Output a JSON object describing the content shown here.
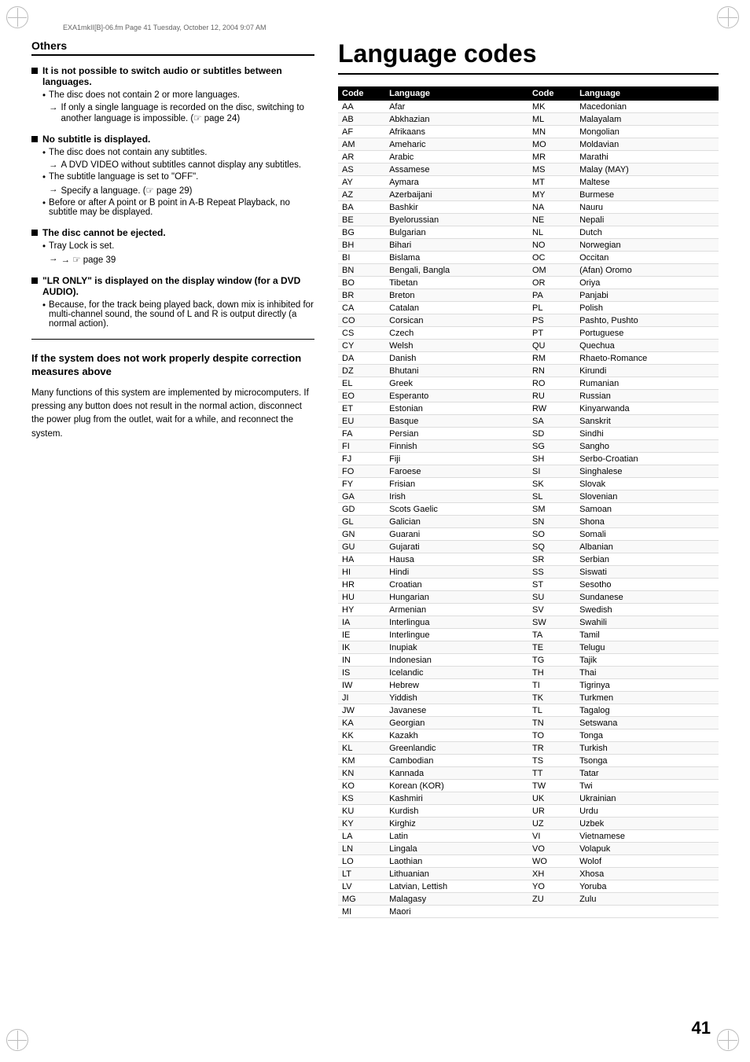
{
  "page": {
    "file_header": "EXA1mkII[B]-06.fm  Page 41  Tuesday, October 12, 2004  9:07 AM",
    "title": "Language codes",
    "page_number": "41"
  },
  "left": {
    "section_heading": "Others",
    "bullets": [
      {
        "id": "bullet1",
        "title": "It is not possible to switch audio or subtitles between languages.",
        "sub_items": [
          {
            "type": "bullet",
            "text": "The disc does not contain 2 or more languages."
          },
          {
            "type": "arrow",
            "text": "If only a single language is recorded on the disc, switching to another language is impossible. ("
          },
          {
            "type": "arrow_ref",
            "text": " page 24)"
          }
        ]
      },
      {
        "id": "bullet2",
        "title": "No subtitle is displayed.",
        "sub_items": [
          {
            "type": "bullet",
            "text": "The disc does not contain any subtitles."
          },
          {
            "type": "arrow",
            "text": "A DVD VIDEO without subtitles cannot display any subtitles."
          },
          {
            "type": "bullet",
            "text": "The subtitle language is set to “OFF”."
          },
          {
            "type": "arrow",
            "text": "Specify a language. (⌇ page 29)"
          },
          {
            "type": "bullet",
            "text": "Before or after A point or B point in A-B Repeat Playback, no subtitle may be displayed."
          }
        ]
      },
      {
        "id": "bullet3",
        "title": "The disc cannot be ejected.",
        "sub_items": [
          {
            "type": "bullet",
            "text": "Tray Lock is set."
          },
          {
            "type": "arrow",
            "text": "→ ⌇ page 39"
          }
        ]
      },
      {
        "id": "bullet4",
        "title": "“LR ONLY” is displayed on the display window (for a DVD AUDIO).",
        "sub_items": [
          {
            "type": "bullet",
            "text": "Because, for the track being played back, down mix is inhibited for multi-channel sound, the sound of L and R is output directly (a normal action)."
          }
        ]
      }
    ],
    "sub_section": {
      "heading": "If the system does not work properly despite correction measures above",
      "body": "Many functions of this system are implemented by microcomputers. If pressing any button does not result in the normal action, disconnect the power plug from the outlet, wait for a while, and reconnect the system."
    }
  },
  "right": {
    "table_header": [
      "Code",
      "Language",
      "Code",
      "Language"
    ],
    "languages": [
      [
        "AA",
        "Afar",
        "MK",
        "Macedonian"
      ],
      [
        "AB",
        "Abkhazian",
        "ML",
        "Malayalam"
      ],
      [
        "AF",
        "Afrikaans",
        "MN",
        "Mongolian"
      ],
      [
        "AM",
        "Ameharic",
        "MO",
        "Moldavian"
      ],
      [
        "AR",
        "Arabic",
        "MR",
        "Marathi"
      ],
      [
        "AS",
        "Assamese",
        "MS",
        "Malay (MAY)"
      ],
      [
        "AY",
        "Aymara",
        "MT",
        "Maltese"
      ],
      [
        "AZ",
        "Azerbaijani",
        "MY",
        "Burmese"
      ],
      [
        "BA",
        "Bashkir",
        "NA",
        "Nauru"
      ],
      [
        "BE",
        "Byelorussian",
        "NE",
        "Nepali"
      ],
      [
        "BG",
        "Bulgarian",
        "NL",
        "Dutch"
      ],
      [
        "BH",
        "Bihari",
        "NO",
        "Norwegian"
      ],
      [
        "BI",
        "Bislama",
        "OC",
        "Occitan"
      ],
      [
        "BN",
        "Bengali, Bangla",
        "OM",
        "(Afan) Oromo"
      ],
      [
        "BO",
        "Tibetan",
        "OR",
        "Oriya"
      ],
      [
        "BR",
        "Breton",
        "PA",
        "Panjabi"
      ],
      [
        "CA",
        "Catalan",
        "PL",
        "Polish"
      ],
      [
        "CO",
        "Corsican",
        "PS",
        "Pashto, Pushto"
      ],
      [
        "CS",
        "Czech",
        "PT",
        "Portuguese"
      ],
      [
        "CY",
        "Welsh",
        "QU",
        "Quechua"
      ],
      [
        "DA",
        "Danish",
        "RM",
        "Rhaeto-Romance"
      ],
      [
        "DZ",
        "Bhutani",
        "RN",
        "Kirundi"
      ],
      [
        "EL",
        "Greek",
        "RO",
        "Rumanian"
      ],
      [
        "EO",
        "Esperanto",
        "RU",
        "Russian"
      ],
      [
        "ET",
        "Estonian",
        "RW",
        "Kinyarwanda"
      ],
      [
        "EU",
        "Basque",
        "SA",
        "Sanskrit"
      ],
      [
        "FA",
        "Persian",
        "SD",
        "Sindhi"
      ],
      [
        "FI",
        "Finnish",
        "SG",
        "Sangho"
      ],
      [
        "FJ",
        "Fiji",
        "SH",
        "Serbo-Croatian"
      ],
      [
        "FO",
        "Faroese",
        "SI",
        "Singhalese"
      ],
      [
        "FY",
        "Frisian",
        "SK",
        "Slovak"
      ],
      [
        "GA",
        "Irish",
        "SL",
        "Slovenian"
      ],
      [
        "GD",
        "Scots Gaelic",
        "SM",
        "Samoan"
      ],
      [
        "GL",
        "Galician",
        "SN",
        "Shona"
      ],
      [
        "GN",
        "Guarani",
        "SO",
        "Somali"
      ],
      [
        "GU",
        "Gujarati",
        "SQ",
        "Albanian"
      ],
      [
        "HA",
        "Hausa",
        "SR",
        "Serbian"
      ],
      [
        "HI",
        "Hindi",
        "SS",
        "Siswati"
      ],
      [
        "HR",
        "Croatian",
        "ST",
        "Sesotho"
      ],
      [
        "HU",
        "Hungarian",
        "SU",
        "Sundanese"
      ],
      [
        "HY",
        "Armenian",
        "SV",
        "Swedish"
      ],
      [
        "IA",
        "Interlingua",
        "SW",
        "Swahili"
      ],
      [
        "IE",
        "Interlingue",
        "TA",
        "Tamil"
      ],
      [
        "IK",
        "Inupiak",
        "TE",
        "Telugu"
      ],
      [
        "IN",
        "Indonesian",
        "TG",
        "Tajik"
      ],
      [
        "IS",
        "Icelandic",
        "TH",
        "Thai"
      ],
      [
        "IW",
        "Hebrew",
        "TI",
        "Tigrinya"
      ],
      [
        "JI",
        "Yiddish",
        "TK",
        "Turkmen"
      ],
      [
        "JW",
        "Javanese",
        "TL",
        "Tagalog"
      ],
      [
        "KA",
        "Georgian",
        "TN",
        "Setswana"
      ],
      [
        "KK",
        "Kazakh",
        "TO",
        "Tonga"
      ],
      [
        "KL",
        "Greenlandic",
        "TR",
        "Turkish"
      ],
      [
        "KM",
        "Cambodian",
        "TS",
        "Tsonga"
      ],
      [
        "KN",
        "Kannada",
        "TT",
        "Tatar"
      ],
      [
        "KO",
        "Korean (KOR)",
        "TW",
        "Twi"
      ],
      [
        "KS",
        "Kashmiri",
        "UK",
        "Ukrainian"
      ],
      [
        "KU",
        "Kurdish",
        "UR",
        "Urdu"
      ],
      [
        "KY",
        "Kirghiz",
        "UZ",
        "Uzbek"
      ],
      [
        "LA",
        "Latin",
        "VI",
        "Vietnamese"
      ],
      [
        "LN",
        "Lingala",
        "VO",
        "Volapuk"
      ],
      [
        "LO",
        "Laothian",
        "WO",
        "Wolof"
      ],
      [
        "LT",
        "Lithuanian",
        "XH",
        "Xhosa"
      ],
      [
        "LV",
        "Latvian, Lettish",
        "YO",
        "Yoruba"
      ],
      [
        "MG",
        "Malagasy",
        "ZU",
        "Zulu"
      ],
      [
        "MI",
        "Maori",
        "",
        ""
      ]
    ]
  }
}
